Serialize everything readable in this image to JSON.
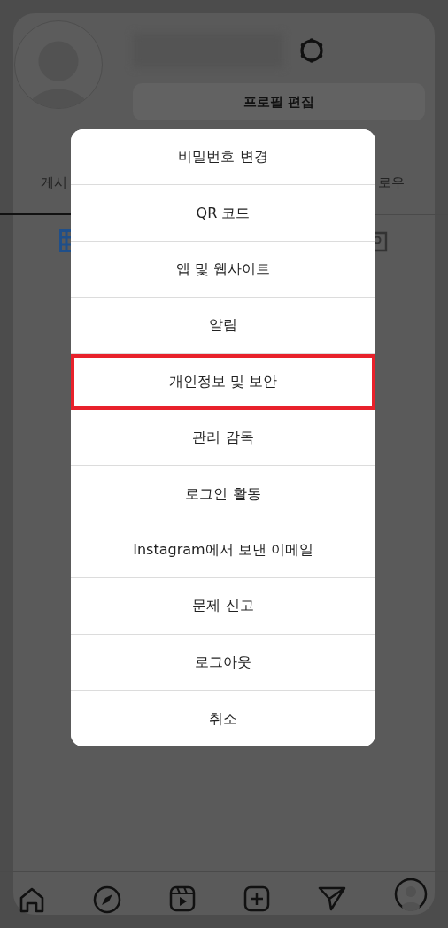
{
  "profile": {
    "edit_button": "프로필 편집"
  },
  "stats": [
    {
      "label": "게시"
    },
    {
      "label": "로우"
    }
  ],
  "menu": [
    {
      "label": "비밀번호 변경",
      "highlighted": false
    },
    {
      "label": "QR 코드",
      "highlighted": false
    },
    {
      "label": "앱 및 웹사이트",
      "highlighted": false
    },
    {
      "label": "알림",
      "highlighted": false
    },
    {
      "label": "개인정보 및 보안",
      "highlighted": true
    },
    {
      "label": "관리 감독",
      "highlighted": false
    },
    {
      "label": "로그인 활동",
      "highlighted": false
    },
    {
      "label": "Instagram에서 보낸 이메일",
      "highlighted": false
    },
    {
      "label": "문제 신고",
      "highlighted": false
    },
    {
      "label": "로그아웃",
      "highlighted": false
    },
    {
      "label": "취소",
      "highlighted": false
    }
  ]
}
